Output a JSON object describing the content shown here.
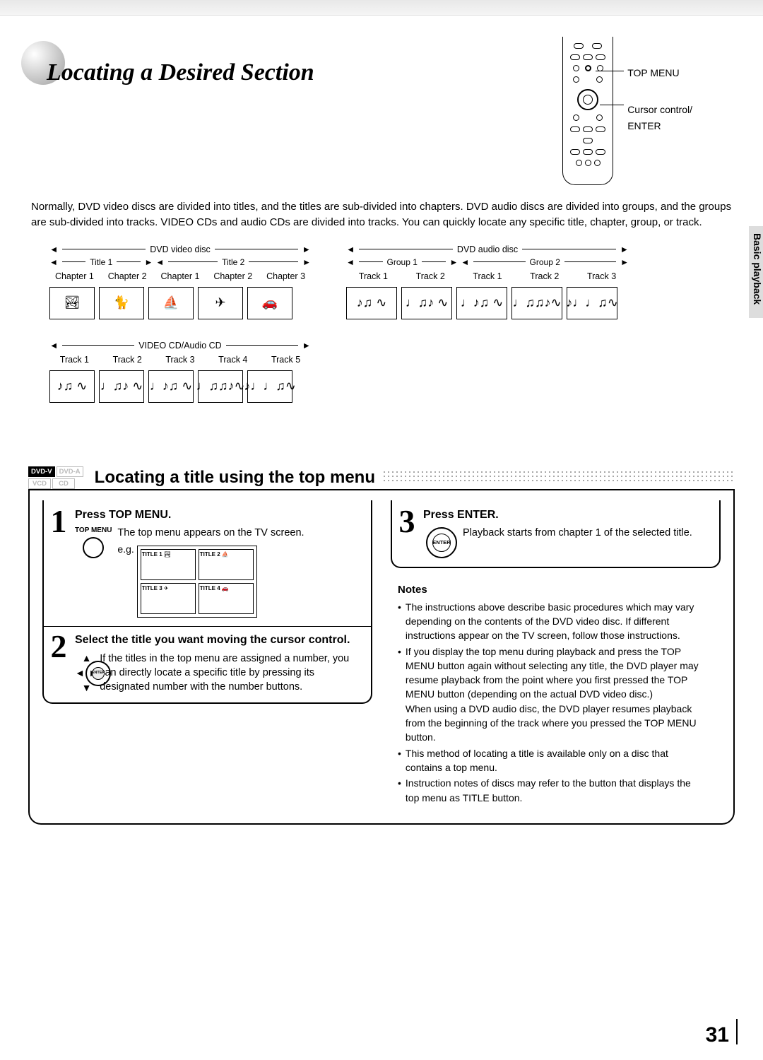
{
  "title": "Locating a Desired Section",
  "remote": {
    "label_top": "TOP MENU",
    "label_cursor": "Cursor control/",
    "label_enter": "ENTER"
  },
  "sideTab": "Basic playback",
  "intro": "Normally, DVD video discs are divided into titles, and the titles are sub-divided into chapters. DVD audio discs are divided into groups, and the groups are sub-divided into tracks. VIDEO CDs and audio CDs are divided into tracks. You can quickly locate any specific title, chapter, group, or track.",
  "diagrams": {
    "dvdv": {
      "label": "DVD video disc",
      "groups": [
        "Title 1",
        "Title 2"
      ],
      "items": [
        "Chapter 1",
        "Chapter 2",
        "Chapter 1",
        "Chapter 2",
        "Chapter 3"
      ]
    },
    "dvda": {
      "label": "DVD audio disc",
      "groups": [
        "Group 1",
        "Group 2"
      ],
      "items": [
        "Track 1",
        "Track 2",
        "Track 1",
        "Track 2",
        "Track 3"
      ]
    },
    "vcd": {
      "label": "VIDEO CD/Audio CD",
      "items": [
        "Track 1",
        "Track 2",
        "Track 3",
        "Track 4",
        "Track 5"
      ]
    }
  },
  "formats": {
    "dvdv": "DVD-V",
    "dvda": "DVD-A",
    "vcd": "VCD",
    "cd": "CD"
  },
  "sectionTitle": "Locating a title using the top menu",
  "steps": {
    "s1": {
      "num": "1",
      "title": "Press TOP MENU.",
      "btn": "TOP MENU",
      "text": "The top menu appears on the TV screen.",
      "eg": "e.g.",
      "tiles": [
        "TITLE 1",
        "TITLE 2",
        "TITLE 3",
        "TITLE 4"
      ]
    },
    "s2": {
      "num": "2",
      "title": "Select the title you want moving the cursor control.",
      "text": "If the titles in the top menu are assigned a number, you can directly locate a specific title by pressing its designated number with the number buttons.",
      "icon_center": "ENTER"
    },
    "s3": {
      "num": "3",
      "title": "Press ENTER.",
      "text": "Playback starts from chapter 1 of the selected title.",
      "icon_center": "ENTER"
    }
  },
  "notes": {
    "heading": "Notes",
    "items": [
      "The instructions above describe basic procedures which may vary depending on the contents of the DVD video disc. If different instructions appear on the TV screen, follow those instructions.",
      "If you display the top menu during playback and press the TOP MENU button again without selecting any title, the DVD player may resume playback from the point where you first pressed the TOP MENU button (depending on the actual DVD video disc.)\nWhen using a DVD audio disc, the DVD player resumes playback from the beginning of the track where you pressed the TOP MENU button.",
      "This method of locating a title is available only on a disc that contains a top menu.",
      "Instruction notes of discs may refer to the button that displays the top menu as TITLE button."
    ]
  },
  "pageNum": "31"
}
